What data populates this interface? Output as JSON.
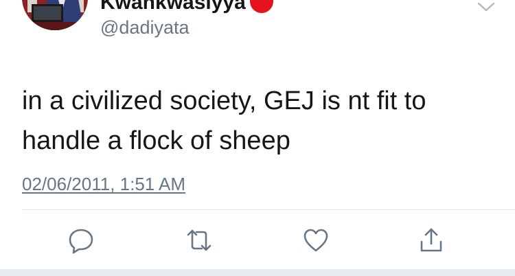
{
  "user": {
    "display_name": "Kwankwasiyya",
    "handle": "@dadiyata"
  },
  "tweet": {
    "text_line1": "in a civilized society, GEJ is nt fit to",
    "text_line2": "handle a flock of sheep",
    "timestamp": "02/06/2011, 1:51 AM"
  },
  "icons": {
    "menu": "chevron-down-icon",
    "reply": "speech-bubble-icon",
    "retweet": "retweet-arrows-icon",
    "like": "heart-icon",
    "share": "share-upload-icon",
    "badge": "red-circle-emoji"
  },
  "colors": {
    "text": "#14171a",
    "muted": "#657786",
    "badge": "#e3121c",
    "icon": "#657786"
  }
}
